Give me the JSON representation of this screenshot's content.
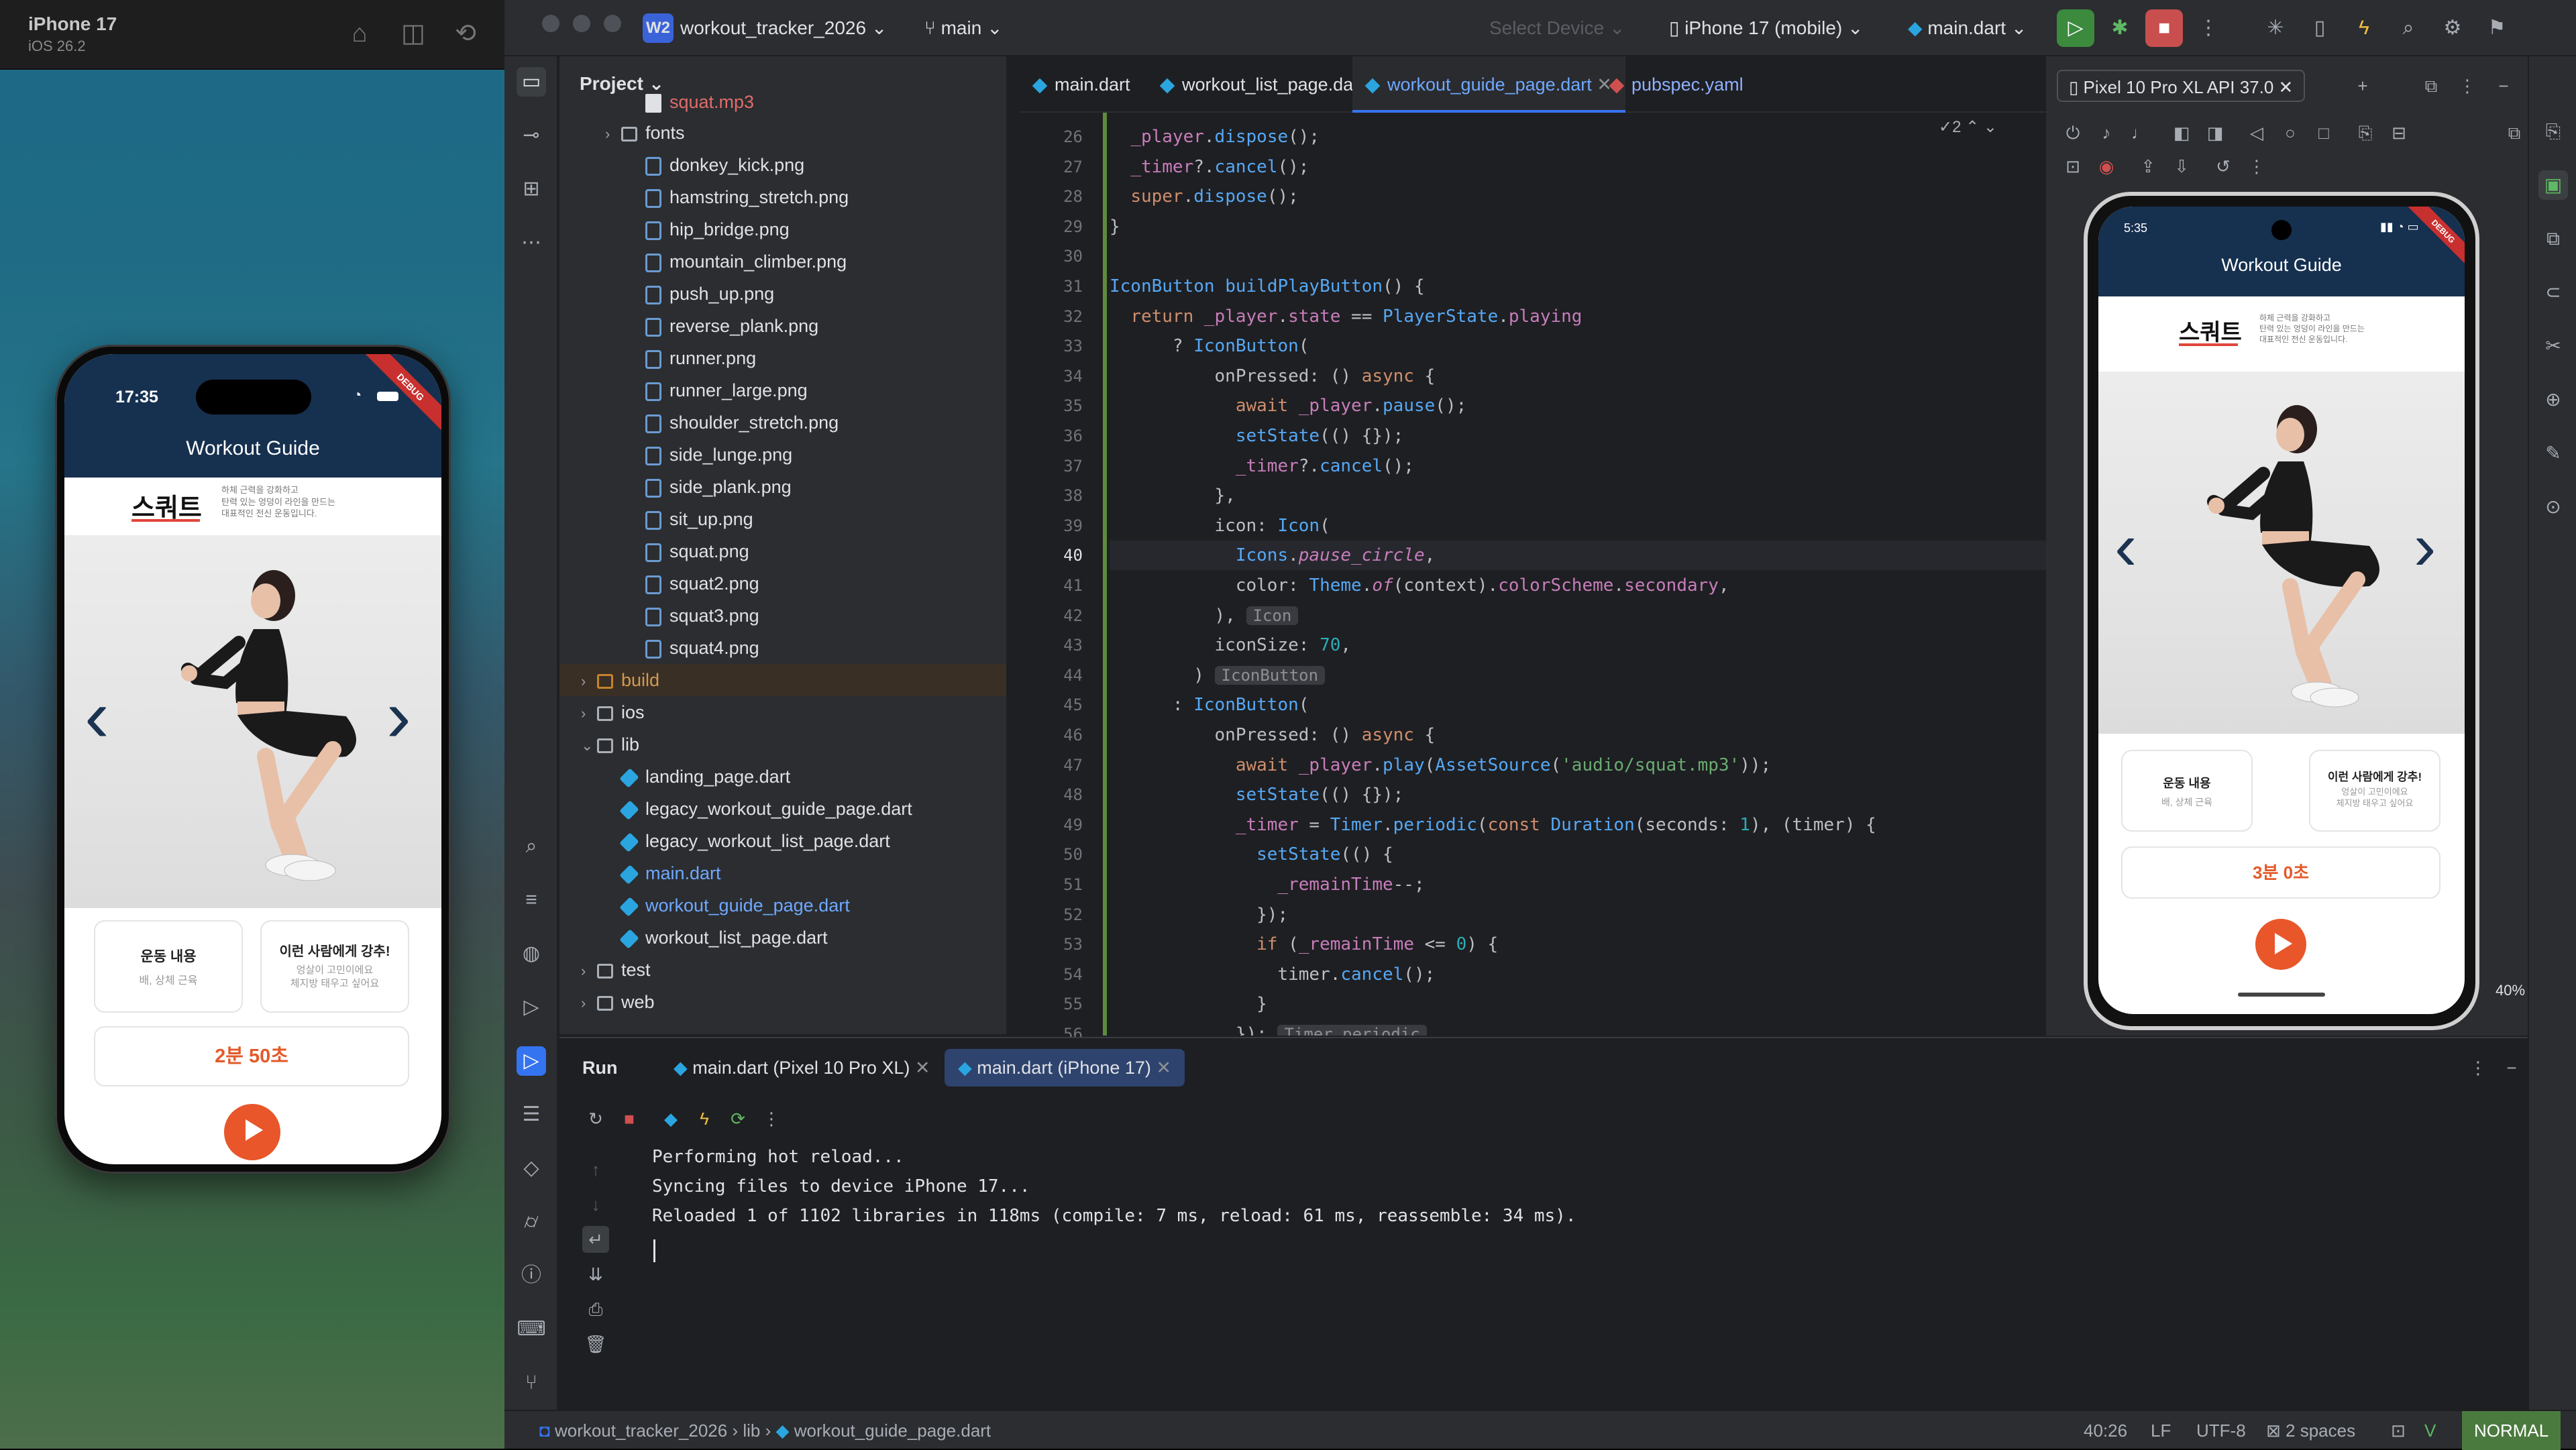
{
  "simulator": {
    "device_name": "iPhone 17",
    "os_version": "iOS 26.2",
    "icons": [
      "home-icon",
      "screenshot-icon",
      "rotate-icon"
    ]
  },
  "iphone_app": {
    "time": "17:35",
    "title": "Workout Guide",
    "debug_badge": "DEBUG",
    "exercise_name": "스쿼트",
    "description": "하체 근력을 강화하고\n탄력 있는 엉덩이 라인을 만드는\n대표적인 전신 운동입니다.",
    "card1_title": "운동 내용",
    "card1_sub": "배, 상체 근육",
    "card2_title": "이런 사람에게 강추!",
    "card2_sub": "엉살이 고민이에요\n체지방 태우고 싶어요",
    "timer": "2분 50초"
  },
  "android_app": {
    "time": "5:35",
    "title": "Workout Guide",
    "exercise_name": "스쿼트",
    "description": "하체 근력을 강화하고\n탄력 있는 엉덩이 라인을 만드는\n대표적인 전신 운동입니다.",
    "card1_title": "운동 내용",
    "card1_sub": "배, 상체 근육",
    "card2_title": "이런 사람에게 강추!",
    "card2_sub": "엉살이 고민이에요\n체지방 태우고 싶어요",
    "timer": "3분 0초",
    "zoom": "40%"
  },
  "titlebar": {
    "project_badge": "W2",
    "project_name": "workout_tracker_2026",
    "branch": "main",
    "select_device": "Select Device",
    "device": "iPhone 17 (mobile)",
    "run_config": "main.dart"
  },
  "project_panel": {
    "title": "Project",
    "rows": [
      {
        "label": "squat.mp3",
        "kind": "mp3",
        "indent": 3
      },
      {
        "label": "fonts",
        "kind": "folder",
        "indent": 2,
        "arrow": "›"
      },
      {
        "label": "donkey_kick.png",
        "kind": "img",
        "indent": 3
      },
      {
        "label": "hamstring_stretch.png",
        "kind": "img",
        "indent": 3
      },
      {
        "label": "hip_bridge.png",
        "kind": "img",
        "indent": 3
      },
      {
        "label": "mountain_climber.png",
        "kind": "img",
        "indent": 3
      },
      {
        "label": "push_up.png",
        "kind": "img",
        "indent": 3
      },
      {
        "label": "reverse_plank.png",
        "kind": "img",
        "indent": 3
      },
      {
        "label": "runner.png",
        "kind": "img",
        "indent": 3
      },
      {
        "label": "runner_large.png",
        "kind": "img",
        "indent": 3
      },
      {
        "label": "shoulder_stretch.png",
        "kind": "img",
        "indent": 3
      },
      {
        "label": "side_lunge.png",
        "kind": "img",
        "indent": 3
      },
      {
        "label": "side_plank.png",
        "kind": "img",
        "indent": 3
      },
      {
        "label": "sit_up.png",
        "kind": "img",
        "indent": 3
      },
      {
        "label": "squat.png",
        "kind": "img",
        "indent": 3
      },
      {
        "label": "squat2.png",
        "kind": "img",
        "indent": 3
      },
      {
        "label": "squat3.png",
        "kind": "img",
        "indent": 3
      },
      {
        "label": "squat4.png",
        "kind": "img",
        "indent": 3
      },
      {
        "label": "build",
        "kind": "folder-orange",
        "indent": 1,
        "arrow": "›"
      },
      {
        "label": "ios",
        "kind": "folder",
        "indent": 1,
        "arrow": "›"
      },
      {
        "label": "lib",
        "kind": "folder",
        "indent": 1,
        "arrow": "⌄"
      },
      {
        "label": "landing_page.dart",
        "kind": "dart",
        "indent": 2
      },
      {
        "label": "legacy_workout_guide_page.dart",
        "kind": "dart",
        "indent": 2
      },
      {
        "label": "legacy_workout_list_page.dart",
        "kind": "dart",
        "indent": 2
      },
      {
        "label": "main.dart",
        "kind": "dart-active",
        "indent": 2
      },
      {
        "label": "workout_guide_page.dart",
        "kind": "dart-active",
        "indent": 2
      },
      {
        "label": "workout_list_page.dart",
        "kind": "dart",
        "indent": 2
      },
      {
        "label": "test",
        "kind": "folder",
        "indent": 1,
        "arrow": "›"
      },
      {
        "label": "web",
        "kind": "folder",
        "indent": 1,
        "arrow": "›"
      }
    ]
  },
  "editor": {
    "tabs": [
      {
        "label": "main.dart"
      },
      {
        "label": "workout_list_page.dart"
      },
      {
        "label": "workout_guide_page.dart",
        "active": true
      },
      {
        "label": "pubspec.yaml"
      }
    ],
    "problems_count": "2",
    "lines": [
      {
        "n": "26",
        "html": "  <span class='fld'>_player</span>.<span class='fn'>dispose</span>();"
      },
      {
        "n": "27",
        "html": "  <span class='fld'>_timer</span>?.<span class='fn'>cancel</span>();"
      },
      {
        "n": "28",
        "html": "  <span class='kw'>super</span>.<span class='fn'>dispose</span>();"
      },
      {
        "n": "29",
        "html": "}"
      },
      {
        "n": "30",
        "html": ""
      },
      {
        "n": "31",
        "html": "<span class='ty'>IconButton</span> <span class='fn'>buildPlayButton</span>() {"
      },
      {
        "n": "32",
        "html": "  <span class='kw'>return</span> <span class='fld'>_player</span>.<span class='fld'>state</span> == <span class='ty'>PlayerState</span>.<span class='fld'>playing</span>"
      },
      {
        "n": "33",
        "html": "      ? <span class='ty'>IconButton</span>("
      },
      {
        "n": "34",
        "html": "          onPressed: () <span class='kw'>async</span> {"
      },
      {
        "n": "35",
        "html": "            <span class='kw'>await</span> <span class='fld'>_player</span>.<span class='fn'>pause</span>();"
      },
      {
        "n": "36",
        "html": "            <span class='fn'>setState</span>(() {});"
      },
      {
        "n": "37",
        "html": "            <span class='fld'>_timer</span>?.<span class='fn'>cancel</span>();"
      },
      {
        "n": "38",
        "html": "          },"
      },
      {
        "n": "39",
        "html": "          icon: <span class='ty'>Icon</span>("
      },
      {
        "n": "40",
        "html": "            <span class='ty'>Icons</span>.<span class='it'>pause_circle</span>,"
      },
      {
        "n": "41",
        "html": "            color: <span class='ty'>Theme</span>.<span class='it'>of</span>(context).<span class='fld'>colorScheme</span>.<span class='fld'>secondary</span>,"
      },
      {
        "n": "42",
        "html": "          ), <span class='hint'>Icon</span>"
      },
      {
        "n": "43",
        "html": "          iconSize: <span class='nm'>70</span>,"
      },
      {
        "n": "44",
        "html": "        ) <span class='hint'>IconButton</span>"
      },
      {
        "n": "45",
        "html": "      : <span class='ty'>IconButton</span>("
      },
      {
        "n": "46",
        "html": "          onPressed: () <span class='kw'>async</span> {"
      },
      {
        "n": "47",
        "html": "            <span class='kw'>await</span> <span class='fld'>_player</span>.<span class='fn'>play</span>(<span class='ty'>AssetSource</span>(<span class='st'>'audio/squat.mp3'</span>));"
      },
      {
        "n": "48",
        "html": "            <span class='fn'>setState</span>(() {});"
      },
      {
        "n": "49",
        "html": "            <span class='fld'>_timer</span> = <span class='ty'>Timer</span>.<span class='fn'>periodic</span>(<span class='kw'>const</span> <span class='ty'>Duration</span>(seconds: <span class='nm'>1</span>), (timer) {"
      },
      {
        "n": "50",
        "html": "              <span class='fn'>setState</span>(() {"
      },
      {
        "n": "51",
        "html": "                <span class='fld'>_remainTime</span>--;"
      },
      {
        "n": "52",
        "html": "              });"
      },
      {
        "n": "53",
        "html": "              <span class='kw'>if</span> (<span class='fld'>_remainTime</span> &lt;= <span class='nm'>0</span>) {"
      },
      {
        "n": "54",
        "html": "                timer.<span class='fn'>cancel</span>();"
      },
      {
        "n": "55",
        "html": "              }"
      },
      {
        "n": "56",
        "html": "            }); <span class='hint'>Timer.periodic</span>"
      }
    ]
  },
  "emulator": {
    "tab": "Pixel 10 Pro XL API 37.0"
  },
  "run_panel": {
    "title": "Run",
    "tabs": [
      {
        "label": "main.dart (Pixel 10 Pro XL)"
      },
      {
        "label": "main.dart (iPhone 17)",
        "active": true
      }
    ],
    "output": [
      "Performing hot reload...",
      "Syncing files to device iPhone 17...",
      "Reloaded 1 of 1102 libraries in 118ms (compile: 7 ms, reload: 61 ms, reassemble: 34 ms)."
    ]
  },
  "statusbar": {
    "breadcrumb": [
      "workout_tracker_2026",
      "lib",
      "workout_guide_page.dart"
    ],
    "position": "40:26",
    "line_sep": "LF",
    "encoding": "UTF-8",
    "indent": "2 spaces",
    "mode": "NORMAL"
  }
}
